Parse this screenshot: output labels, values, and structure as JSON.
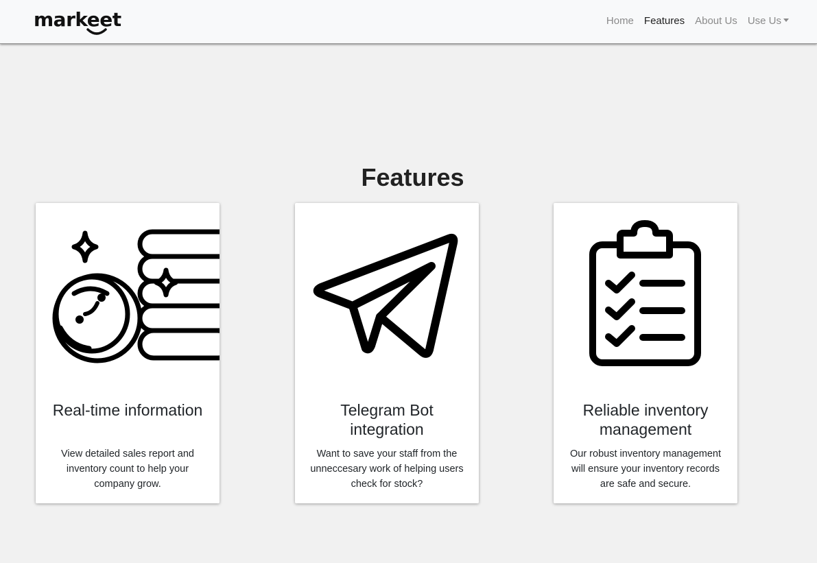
{
  "navbar": {
    "brand": "markeet",
    "links": [
      "Home",
      "Features",
      "About Us",
      "Use Us"
    ],
    "active_link": "Features"
  },
  "features": {
    "title": "Features",
    "cards": [
      {
        "icon": "coins-stack-icon",
        "title": "Real-time information",
        "text": "View detailed sales report and inventory count to help your company grow."
      },
      {
        "icon": "paper-plane-icon",
        "title": "Telegram Bot integration",
        "text": "Want to save your staff from the unneccesary work of helping users check for stock?"
      },
      {
        "icon": "clipboard-checklist-icon",
        "title": "Reliable inventory management",
        "text": "Our robust inventory management will ensure your inventory records are safe and secure."
      }
    ]
  }
}
